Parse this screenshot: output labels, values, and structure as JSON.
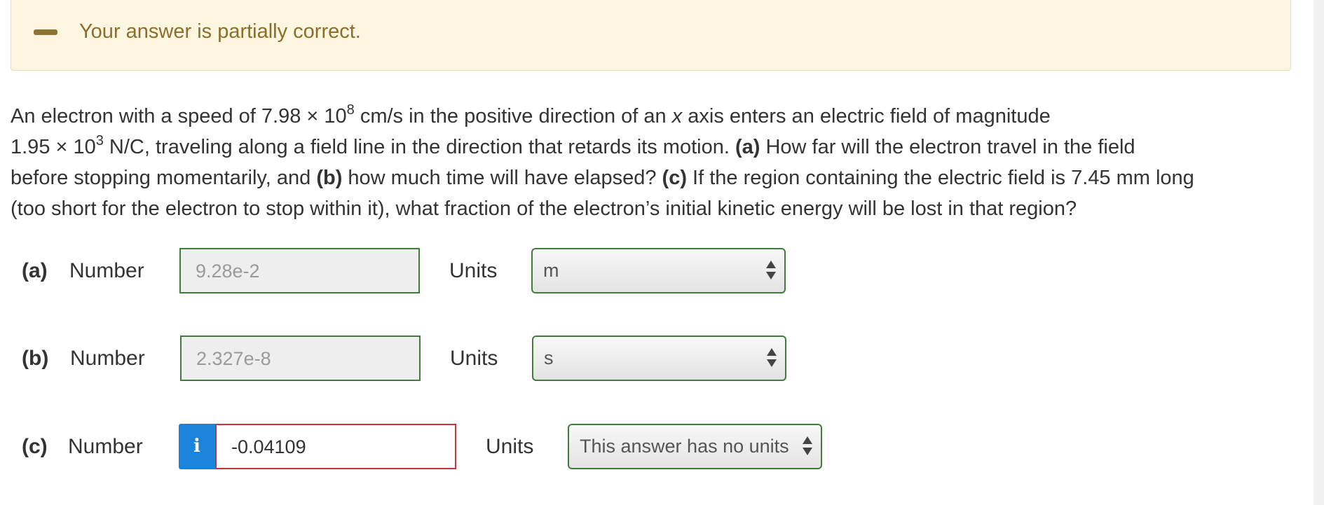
{
  "feedback": {
    "message": "Your answer is partially correct.",
    "icon": "minus-icon",
    "background_color": "#fcf6e1",
    "text_color": "#8b6d2c"
  },
  "question": {
    "line1": {
      "pre": "An electron with a speed of 7.98 × 10",
      "sup": "8",
      "mid": " cm/s in the positive direction of an ",
      "var": "x",
      "post": " axis enters an electric field of magnitude"
    },
    "line2": {
      "pre": "1.95 × 10",
      "sup": "3",
      "mid": " N/C, traveling along a field line in the direction that retards its motion. ",
      "part_a": "(a)",
      "post": " How far will the electron travel in the field"
    },
    "line3": {
      "pre": "before stopping momentarily, and ",
      "part_b": "(b)",
      "mid": " how much time will have elapsed? ",
      "part_c": "(c)",
      "post": " If the region containing the electric field is 7.45 mm long"
    },
    "line4": {
      "text": "(too short for the electron to stop within it), what fraction of the electron’s initial kinetic energy will be lost in that region?"
    }
  },
  "answers": [
    {
      "part": "(a)",
      "number_label": "Number",
      "value": "9.28e-2",
      "status": "correct",
      "units_label": "Units",
      "unit": "m"
    },
    {
      "part": "(b)",
      "number_label": "Number",
      "value": "2.327e-8",
      "status": "correct",
      "units_label": "Units",
      "unit": "s"
    },
    {
      "part": "(c)",
      "number_label": "Number",
      "value": "-0.04109",
      "status": "incorrect",
      "info_icon": "info-icon",
      "info_glyph": "i",
      "units_label": "Units",
      "unit": "This answer has no units"
    }
  ],
  "colors": {
    "correct_border": "#3e7d3a",
    "incorrect_border": "#c3353b",
    "info_button": "#1c84d8"
  }
}
